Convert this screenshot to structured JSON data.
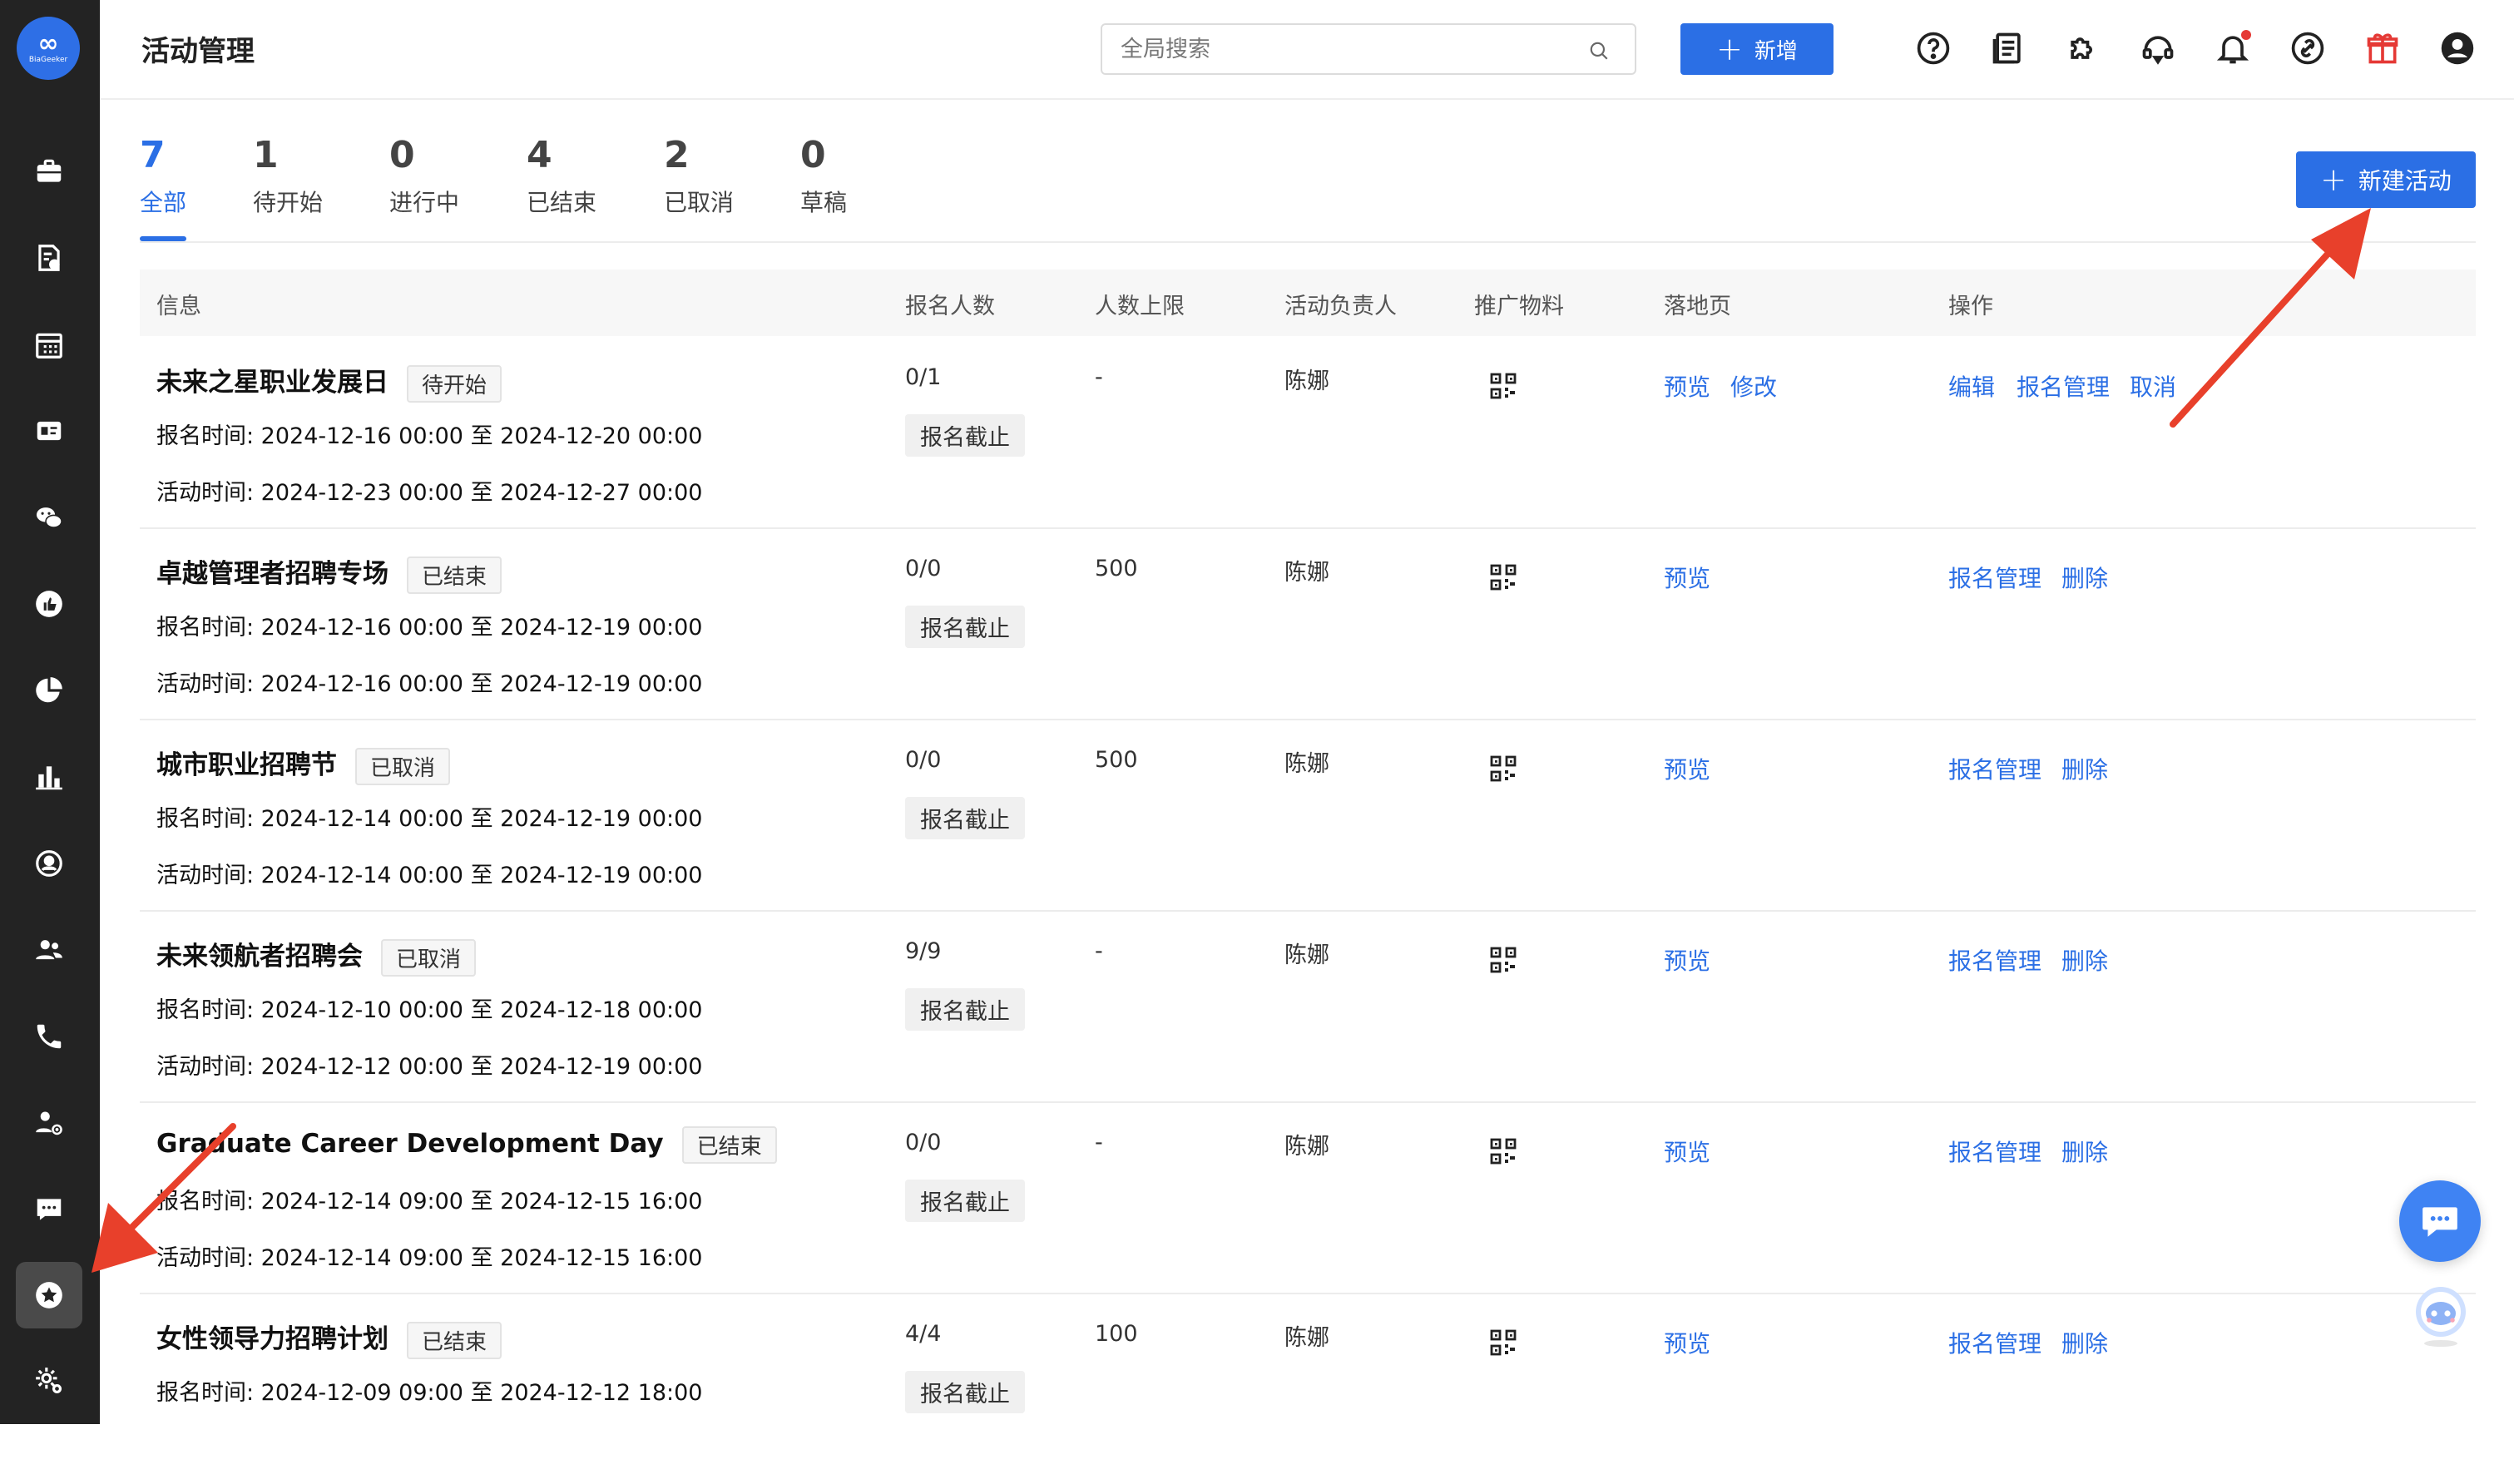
{
  "sidebar": {
    "logo_text": "BiaGeeker",
    "items": [
      {
        "icon": "briefcase-icon"
      },
      {
        "icon": "job-document-icon"
      },
      {
        "icon": "calendar-grid-icon"
      },
      {
        "icon": "id-card-icon"
      },
      {
        "icon": "wechat-icon"
      },
      {
        "icon": "thumbs-up-icon"
      },
      {
        "icon": "pie-chart-icon"
      },
      {
        "icon": "bar-chart-icon"
      },
      {
        "icon": "person-circle-icon"
      },
      {
        "icon": "users-icon"
      },
      {
        "icon": "phone-icon"
      },
      {
        "icon": "user-settings-icon"
      },
      {
        "icon": "message-icon"
      },
      {
        "icon": "star-badge-icon",
        "active": true
      },
      {
        "icon": "gear-icon"
      }
    ]
  },
  "header": {
    "title": "活动管理",
    "search_placeholder": "全局搜索",
    "add_label": "新增",
    "icons": [
      "help-icon",
      "document-icon",
      "plugin-icon",
      "support-icon",
      "bell-icon",
      "link-icon",
      "gift-icon",
      "user-avatar-icon"
    ]
  },
  "stats": [
    {
      "count": "7",
      "label": "全部"
    },
    {
      "count": "1",
      "label": "待开始"
    },
    {
      "count": "0",
      "label": "进行中"
    },
    {
      "count": "4",
      "label": "已结束"
    },
    {
      "count": "2",
      "label": "已取消"
    },
    {
      "count": "0",
      "label": "草稿"
    }
  ],
  "new_activity_label": "新建活动",
  "table": {
    "columns": [
      "信息",
      "报名人数",
      "人数上限",
      "活动负责人",
      "推广物料",
      "落地页",
      "操作"
    ],
    "rows": [
      {
        "name": "未来之星职业发展日",
        "status": "待开始",
        "reg_time": "报名时间:  2024-12-16 00:00 至 2024-12-20 00:00",
        "act_time": "活动时间:  2024-12-23 00:00 至 2024-12-27 00:00",
        "signup": "0/1",
        "reg_state": "报名截止",
        "limit": "-",
        "owner": "陈娜",
        "landing": [
          "预览",
          "修改"
        ],
        "actions": [
          "编辑",
          "报名管理",
          "取消"
        ]
      },
      {
        "name": "卓越管理者招聘专场",
        "status": "已结束",
        "reg_time": "报名时间:  2024-12-16 00:00 至 2024-12-19 00:00",
        "act_time": "活动时间:  2024-12-16 00:00 至 2024-12-19 00:00",
        "signup": "0/0",
        "reg_state": "报名截止",
        "limit": "500",
        "owner": "陈娜",
        "landing": [
          "预览"
        ],
        "actions": [
          "报名管理",
          "删除"
        ]
      },
      {
        "name": "城市职业招聘节",
        "status": "已取消",
        "reg_time": "报名时间:  2024-12-14 00:00 至 2024-12-19 00:00",
        "act_time": "活动时间:  2024-12-14 00:00 至 2024-12-19 00:00",
        "signup": "0/0",
        "reg_state": "报名截止",
        "limit": "500",
        "owner": "陈娜",
        "landing": [
          "预览"
        ],
        "actions": [
          "报名管理",
          "删除"
        ]
      },
      {
        "name": "未来领航者招聘会",
        "status": "已取消",
        "reg_time": "报名时间:  2024-12-10 00:00 至 2024-12-18 00:00",
        "act_time": "活动时间:  2024-12-12 00:00 至 2024-12-19 00:00",
        "signup": "9/9",
        "reg_state": "报名截止",
        "limit": "-",
        "owner": "陈娜",
        "landing": [
          "预览"
        ],
        "actions": [
          "报名管理",
          "删除"
        ]
      },
      {
        "name": "Graduate Career Development Day",
        "status": "已结束",
        "reg_time": "报名时间:  2024-12-14 09:00 至 2024-12-15 16:00",
        "act_time": "活动时间:  2024-12-14 09:00 至 2024-12-15 16:00",
        "signup": "0/0",
        "reg_state": "报名截止",
        "limit": "-",
        "owner": "陈娜",
        "landing": [
          "预览"
        ],
        "actions": [
          "报名管理",
          "删除"
        ]
      },
      {
        "name": "女性领导力招聘计划",
        "status": "已结束",
        "reg_time": "报名时间:  2024-12-09 09:00 至 2024-12-12 18:00",
        "act_time": "",
        "signup": "4/4",
        "reg_state": "报名截止",
        "limit": "100",
        "owner": "陈娜",
        "landing": [
          "预览"
        ],
        "actions": [
          "报名管理",
          "删除"
        ]
      }
    ]
  },
  "colors": {
    "accent": "#2b6fe5",
    "sidebar_bg": "#232323",
    "annotation_arrow": "#e8402b"
  }
}
